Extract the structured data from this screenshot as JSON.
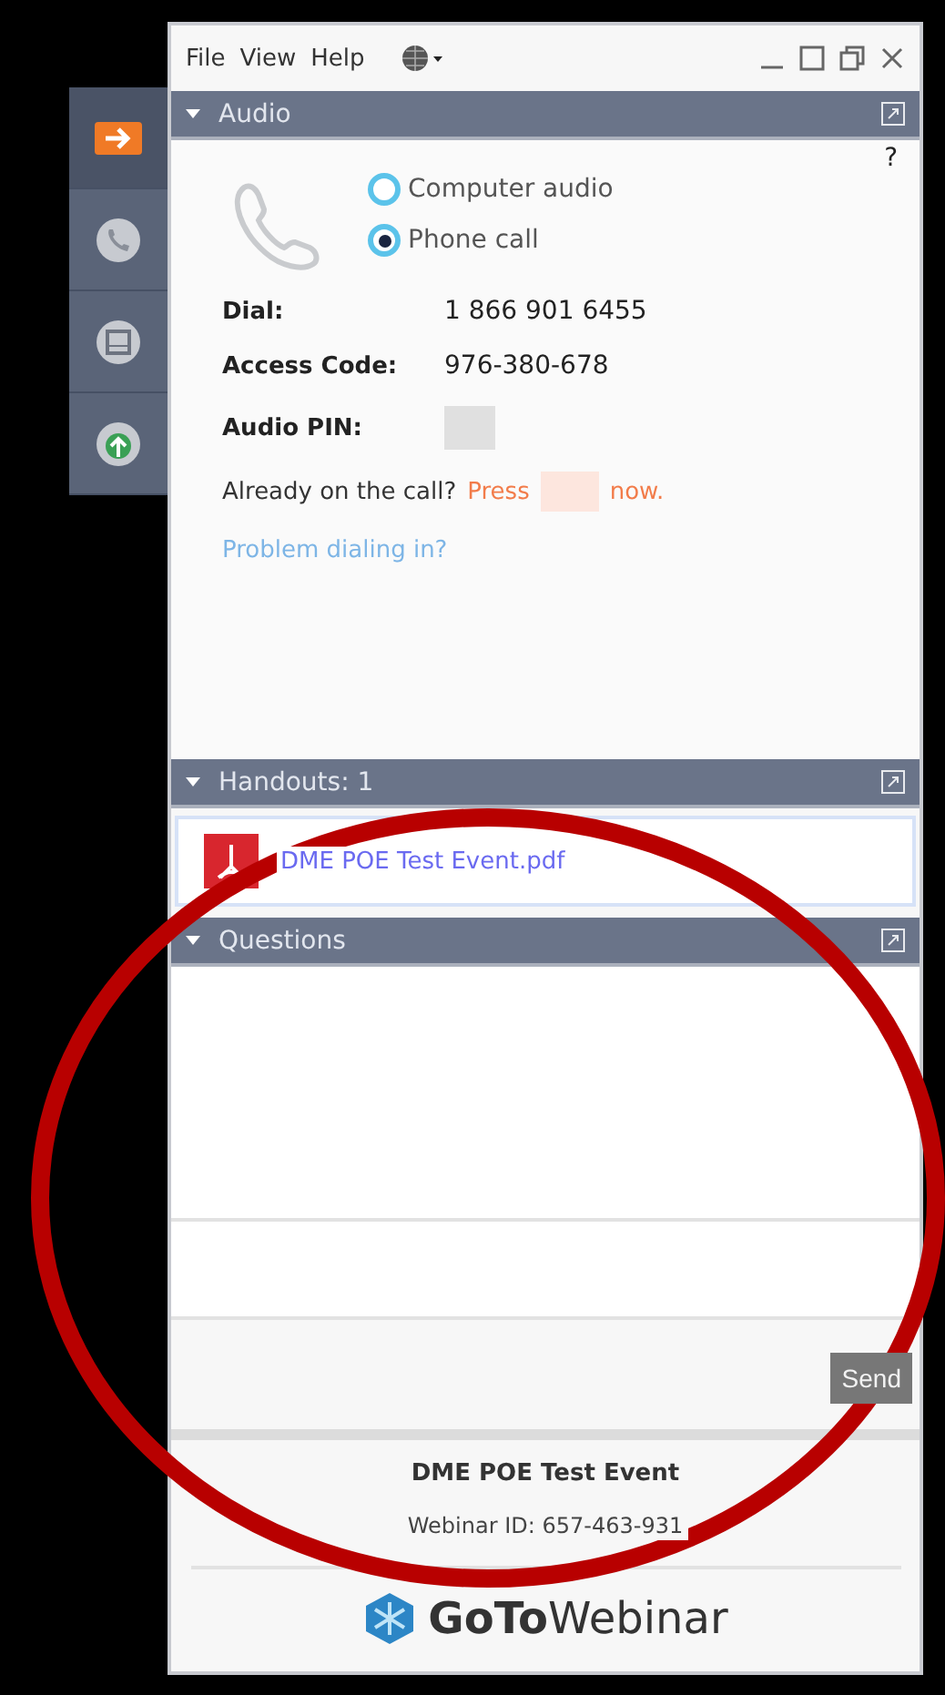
{
  "menu": [
    "File",
    "View",
    "Help"
  ],
  "dock": [
    {
      "kind": "arrow",
      "selected": true
    },
    {
      "kind": "phone",
      "selected": false
    },
    {
      "kind": "screen",
      "selected": false
    },
    {
      "kind": "upload",
      "selected": false
    }
  ],
  "audio": {
    "title": "Audio",
    "help": "?",
    "options": [
      {
        "label": "Computer audio",
        "selected": false
      },
      {
        "label": "Phone call",
        "selected": true
      }
    ],
    "fields": [
      {
        "label": "Dial:",
        "value": "1 866 901 6455"
      },
      {
        "label": "Access Code:",
        "value": "976-380-678"
      },
      {
        "label": "Audio PIN:",
        "redacted": true
      }
    ],
    "already": "Already on the call?",
    "press": "Press",
    "now": "now.",
    "problem": "Problem dialing in?"
  },
  "handouts": {
    "title": "Handouts: 1",
    "files": [
      "DME POE Test Event.pdf"
    ]
  },
  "questions": {
    "title": "Questions",
    "send": "Send"
  },
  "footer": {
    "event": "DME POE Test Event",
    "webinar_id": "Webinar ID: 657-463-931",
    "brand_bold": "GoTo",
    "brand_light": "Webinar"
  }
}
